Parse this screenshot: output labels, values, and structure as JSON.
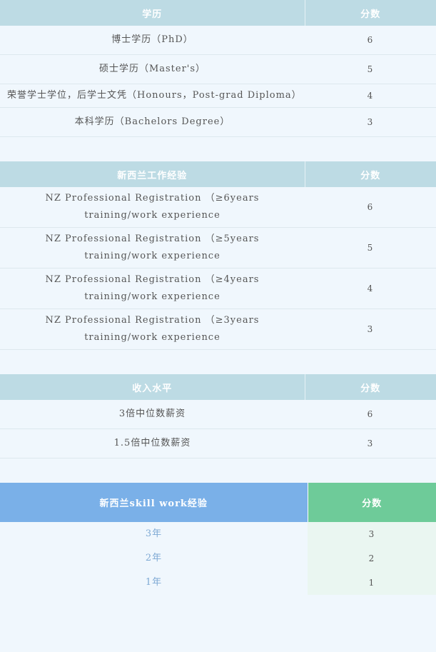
{
  "education": {
    "header": {
      "col1": "学历",
      "col2": "分数"
    },
    "rows": [
      {
        "label": "博士学历（PhD）",
        "score": "6"
      },
      {
        "label": "硕士学历（Master's）",
        "score": "5"
      },
      {
        "label": "荣誉学士学位，后学士文凭（Honours，Post-grad Diploma）",
        "score": "4"
      },
      {
        "label": "本科学历（Bachelors Degree）",
        "score": "3"
      }
    ]
  },
  "nz_work": {
    "header": {
      "col1": "新西兰工作经验",
      "col2": "分数"
    },
    "rows": [
      {
        "label": "NZ Professional Registration （≥6years training/work experience",
        "score": "6"
      },
      {
        "label": "NZ Professional Registration （≥5years training/work experience",
        "score": "5"
      },
      {
        "label": "NZ Professional Registration （≥4years training/work experience",
        "score": "4"
      },
      {
        "label": "NZ Professional Registration （≥3years training/work experience",
        "score": "3"
      }
    ]
  },
  "income": {
    "header": {
      "col1": "收入水平",
      "col2": "分数"
    },
    "rows": [
      {
        "label": "3倍中位数薪资",
        "score": "6"
      },
      {
        "label": "1.5倍中位数薪资",
        "score": "3"
      }
    ]
  },
  "skill_work": {
    "header": {
      "col1": "新西兰skill work经验",
      "col2": "分数"
    },
    "rows": [
      {
        "label": "3年",
        "score": "3"
      },
      {
        "label": "2年",
        "score": "2"
      },
      {
        "label": "1年",
        "score": "1"
      }
    ]
  }
}
